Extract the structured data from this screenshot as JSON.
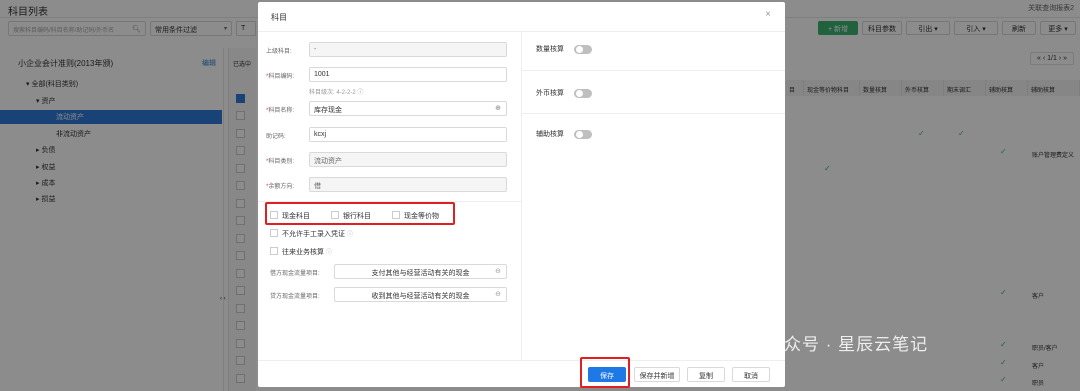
{
  "app": {
    "page_title": "科目列表",
    "top_right": "关联查询报表2",
    "search_placeholder": "搜索科目编码/科目名称/助记码/外币名",
    "filter_select": "常用条件过滤",
    "filter_btn": "T",
    "toolbar": {
      "add": "+ 新增",
      "params": "科目参数",
      "export": "引出",
      "import": "引入",
      "refresh": "刷新",
      "more": "更多"
    },
    "pager": "1/1",
    "tree": {
      "title": "小企业会计准则(2013年颁)",
      "edit": "编辑",
      "items": [
        {
          "label": "▾ 全部(科目类别)"
        },
        {
          "label": "▾ 资产"
        },
        {
          "label": "流动资产"
        },
        {
          "label": "非流动资产"
        },
        {
          "label": "▸ 负债"
        },
        {
          "label": "▸ 权益"
        },
        {
          "label": "▸ 成本"
        },
        {
          "label": "▸ 损益"
        }
      ]
    },
    "grid_selected_label": "已选中",
    "columns": [
      "目",
      "现金等价物科目",
      "数量核算",
      "外币核算",
      "期末调汇",
      "辅助核算",
      "辅助核算"
    ],
    "cell_texts": [
      "账户管理费定义",
      "客户",
      "职员/客户",
      "客户",
      "职员"
    ]
  },
  "modal": {
    "title": "科目",
    "close": "×",
    "fields": {
      "parent_label": "上级科目:",
      "parent_value": "-",
      "code_label": "科目编码:",
      "code_value": "1001",
      "level_hint": "科目级次: 4-2-2-2",
      "name_label": "科目名称:",
      "name_value": "库存现金",
      "mnemonic_label": "助记码:",
      "mnemonic_value": "kcxj",
      "category_label": "科目类别:",
      "category_value": "流动资产",
      "direction_label": "余额方向:",
      "direction_value": "借"
    },
    "checkboxes": {
      "cash": "现金科目",
      "bank": "银行科目",
      "cash_equiv": "现金等价物",
      "no_manual": "不允许手工录入凭证",
      "intercourse": "往来业务核算"
    },
    "cashflow": {
      "debit_label": "借方现金流量项目:",
      "debit_value": "支付其他与经营活动有关的现金",
      "credit_label": "贷方现金流量项目:",
      "credit_value": "收到其他与经营活动有关的现金"
    },
    "right": {
      "qty": "数量核算",
      "fx": "外币核算",
      "aux": "辅助核算"
    },
    "buttons": {
      "save": "保存",
      "save_new": "保存并新增",
      "copy": "复制",
      "cancel": "取消"
    }
  },
  "watermark": "公众号 · 星辰云笔记"
}
